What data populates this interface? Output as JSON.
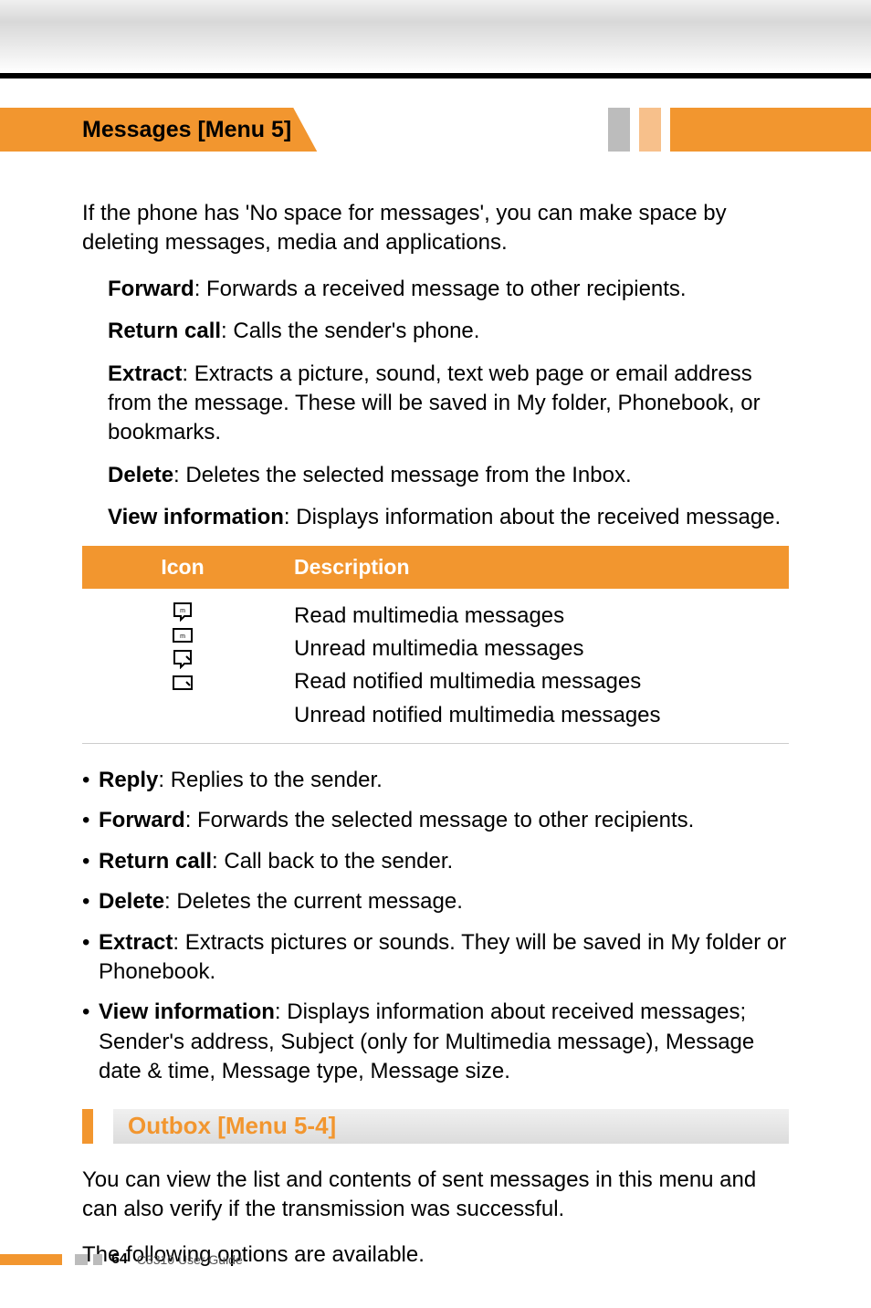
{
  "header": {
    "title": "Messages [Menu 5]"
  },
  "intro": "If the phone has 'No space for messages', you can make space by deleting messages, media and applications.",
  "first_items": [
    {
      "label": "Forward",
      "desc": ": Forwards a received message to other recipients."
    },
    {
      "label": "Return call",
      "desc": ": Calls the sender's phone."
    },
    {
      "label": "Extract",
      "desc": ": Extracts a picture, sound, text web page or email address from the message. These will be saved in My folder, Phonebook, or bookmarks."
    },
    {
      "label": "Delete",
      "desc": ": Deletes the selected message from the Inbox."
    },
    {
      "label": "View information",
      "desc": ": Displays information about the received message."
    }
  ],
  "table": {
    "head_icon": "Icon",
    "head_desc": "Description",
    "rows": [
      "Read multimedia messages",
      "Unread multimedia messages",
      "Read notified multimedia messages",
      "Unread notified multimedia messages"
    ]
  },
  "bullets": [
    {
      "label": "Reply",
      "desc": ": Replies to the sender."
    },
    {
      "label": "Forward",
      "desc": ": Forwards the selected message to other recipients."
    },
    {
      "label": "Return call",
      "desc": ": Call back to the sender."
    },
    {
      "label": "Delete",
      "desc": ": Deletes the current message."
    },
    {
      "label": "Extract",
      "desc": ": Extracts pictures or sounds. They will be saved in My folder or Phonebook."
    },
    {
      "label": "View information",
      "desc": ": Displays information about received messages; Sender's address, Subject (only for Multimedia message), Message date & time, Message type, Message size."
    }
  ],
  "section": {
    "title": "Outbox [Menu 5-4]",
    "body1": "You can view the list and contents of sent messages in this menu and can also verify if the transmission was successful.",
    "body2": "The following options are available."
  },
  "footer": {
    "page": "64",
    "guide": "C3310 User Guide"
  }
}
